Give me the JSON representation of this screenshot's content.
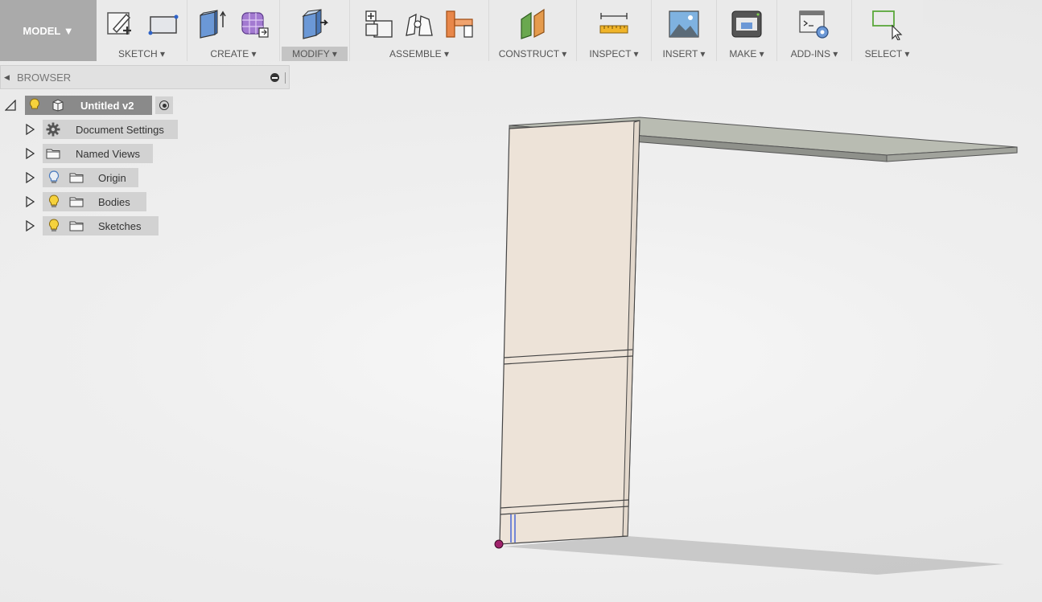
{
  "toolbar": {
    "mode": "MODEL ▼",
    "groups": [
      {
        "label": "SKETCH ▾",
        "icons": [
          "create-sketch-icon",
          "rectangle-icon"
        ]
      },
      {
        "label": "CREATE ▾",
        "icons": [
          "extrude-icon",
          "create-form-icon"
        ]
      },
      {
        "label": "MODIFY ▾",
        "icons": [
          "press-pull-icon"
        ]
      },
      {
        "label": "ASSEMBLE ▾",
        "icons": [
          "new-component-icon",
          "joint-icon",
          "as-built-joint-icon"
        ]
      },
      {
        "label": "CONSTRUCT ▾",
        "icons": [
          "offset-plane-icon"
        ]
      },
      {
        "label": "INSPECT ▾",
        "icons": [
          "measure-icon"
        ]
      },
      {
        "label": "INSERT ▾",
        "icons": [
          "insert-image-icon"
        ]
      },
      {
        "label": "MAKE ▾",
        "icons": [
          "3d-print-icon"
        ]
      },
      {
        "label": "ADD-INS ▾",
        "icons": [
          "scripts-addins-icon"
        ]
      },
      {
        "label": "SELECT ▾",
        "icons": [
          "select-icon"
        ]
      }
    ]
  },
  "browser": {
    "title": "BROWSER",
    "root": "Untitled v2",
    "items": [
      {
        "label": "Document Settings",
        "icon": "gear-icon"
      },
      {
        "label": "Named Views",
        "icon": "folder-icon"
      },
      {
        "label": "Origin",
        "icon": "folder-icon",
        "bulb": "off"
      },
      {
        "label": "Bodies",
        "icon": "folder-icon",
        "bulb": "on"
      },
      {
        "label": "Sketches",
        "icon": "folder-icon",
        "bulb": "on"
      }
    ]
  },
  "colors": {
    "toolbar_bg": "#eaeaea",
    "mode_bg": "#aaaaaa",
    "panel_face": "#ede3d8",
    "shelf_face": "#b5b8ae",
    "origin_point": "#a0226b"
  }
}
